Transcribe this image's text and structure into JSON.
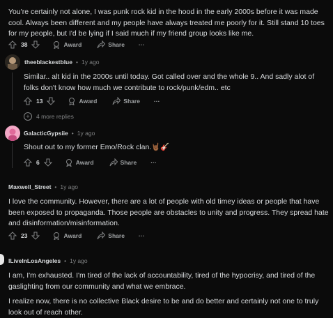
{
  "comments": [
    {
      "text": "You're certainly not alone, I was punk rock kid in the hood in the early 2000s before it was made cool. Always been different and my people have always treated me poorly for it. Still stand 10 toes for my people, but I'd be lying if I said much if my friend group looks like me.",
      "votes": "38"
    },
    {
      "user": "theeblackestblue",
      "time": "1y ago",
      "text": "Similar.. alt kid in the 2000s until today. Got called over and the whole 9.. And sadly alot of folks don't know how much we contribute to rock/punk/edm.. etc",
      "votes": "13",
      "more_replies": "4 more replies"
    },
    {
      "user": "GalacticGypsiie",
      "time": "1y ago",
      "text": "Shout out to my former Emo/Rock clan.🤘🏾🎸",
      "votes": "6"
    },
    {
      "user": "Maxwell_Street",
      "time": "1y ago",
      "text": "I love the community. However, there are a lot of people with old timey ideas or people that have been exposed to propaganda. Those people are obstacles to unity and progress. They spread hate and disinformation/misinformation.",
      "votes": "23"
    },
    {
      "user": "ILiveInLosAngeles",
      "time": "1y ago",
      "text": "I am, I'm exhausted. I'm tired of the lack of accountability, tired of the hypocrisy, and tired of the gaslighting from our community and what we embrace.",
      "text2": "I realize now, there is no collective Black desire to be and do better and certainly not one to truly look out of reach other."
    }
  ],
  "labels": {
    "award": "Award",
    "share": "Share",
    "more": "···",
    "dot": "•"
  },
  "icons": [
    "upvote-icon",
    "downvote-icon",
    "award-icon",
    "share-icon",
    "more-icon",
    "plus-circle-icon"
  ]
}
